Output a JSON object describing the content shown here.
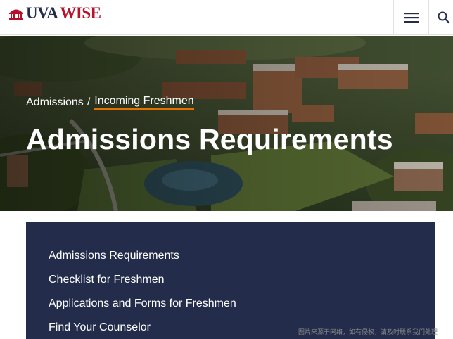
{
  "header": {
    "logo_uva": "UVA",
    "logo_wise": "WISE",
    "menu_icon": "hamburger-menu-icon",
    "search_icon": "search-icon"
  },
  "hero": {
    "breadcrumb": {
      "parent": "Admissions",
      "separator": "/",
      "current": "Incoming Freshmen"
    },
    "title": "Admissions Requirements"
  },
  "section_nav": {
    "items": [
      "Admissions Requirements",
      "Checklist for Freshmen",
      "Applications and Forms for Freshmen",
      "Find Your Counselor"
    ]
  },
  "watermark": "图片来源于网络，如有侵权，请及时联系我们处理",
  "colors": {
    "navy": "#232d4b",
    "brand_red": "#b8102a",
    "accent_orange": "#e57200",
    "white": "#ffffff"
  }
}
